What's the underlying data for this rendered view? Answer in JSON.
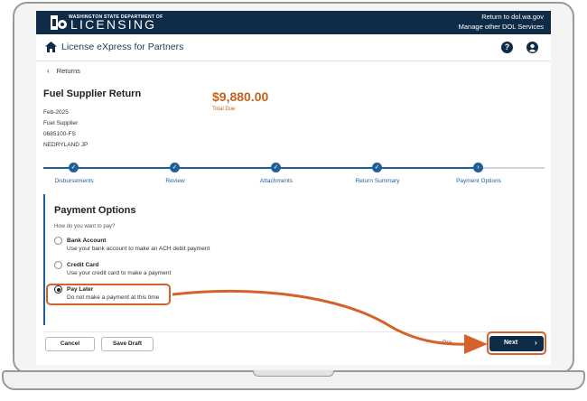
{
  "header": {
    "agency_line": "WASHINGTON STATE DEPARTMENT OF",
    "logo_text": "LICENSING",
    "link_return": "Return to dol.wa.gov",
    "link_services": "Manage other DOL Services"
  },
  "appbar": {
    "title": "License eXpress for Partners",
    "home_icon": "home-icon",
    "help_icon": "help-icon",
    "help_glyph": "?",
    "account_icon": "account-icon"
  },
  "back": {
    "label": "Returns"
  },
  "return_info": {
    "title": "Fuel Supplier Return",
    "period": "Feb-2025",
    "type": "Fuel Supplier",
    "account": "0685100-FS",
    "name": "NEDRYLAND JP",
    "total": "$9,880.00",
    "total_label": "Total Due"
  },
  "stepper": {
    "steps": [
      {
        "label": "Disbursements",
        "state": "complete"
      },
      {
        "label": "Review",
        "state": "complete"
      },
      {
        "label": "Attachments",
        "state": "complete"
      },
      {
        "label": "Return Summary",
        "state": "complete"
      },
      {
        "label": "Payment Options",
        "state": "current"
      }
    ]
  },
  "payment": {
    "title": "Payment Options",
    "question": "How do you want to pay?",
    "options": [
      {
        "label": "Bank Account",
        "desc": "Use your bank account to make an ACH debit payment",
        "checked": false
      },
      {
        "label": "Credit Card",
        "desc": "Use your credit card to make a payment",
        "checked": false
      },
      {
        "label": "Pay Later",
        "desc": "Do not make a payment at this time",
        "checked": true
      }
    ]
  },
  "footer": {
    "cancel": "Cancel",
    "save_draft": "Save Draft",
    "previous": "Pre",
    "next": "Next"
  },
  "colors": {
    "brand_navy": "#0e2b48",
    "step_blue": "#1f5f97",
    "amount_orange": "#c4621d",
    "annotation_orange": "#d4622a"
  }
}
